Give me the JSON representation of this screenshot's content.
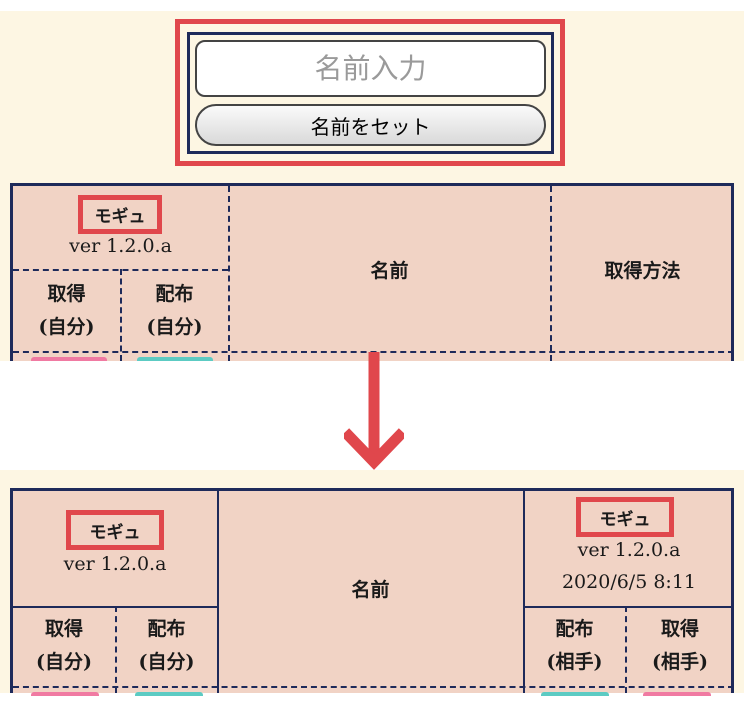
{
  "form": {
    "name_input_placeholder": "名前入力",
    "set_name_button": "名前をセット"
  },
  "before_table": {
    "game_badge": "モギュ",
    "version": "ver 1.2.0.a",
    "col_get_line1": "取得",
    "col_get_line2": "(自分)",
    "col_dist_line1": "配布",
    "col_dist_line2": "(自分)",
    "col_name": "名前",
    "col_method": "取得方法"
  },
  "after_table": {
    "game_badge": "モギュ",
    "version": "ver 1.2.0.a",
    "col_get_line1": "取得",
    "col_get_line2": "(自分)",
    "col_dist_line1": "配布",
    "col_dist_line2": "(自分)",
    "col_name": "名前",
    "partner_badge": "モギュ",
    "partner_version": "ver 1.2.0.a",
    "partner_datetime": "2020/6/5 8:11",
    "col_partner_dist_line1": "配布",
    "col_partner_dist_line2": "(相手)",
    "col_partner_get_line1": "取得",
    "col_partner_get_line2": "(相手)"
  },
  "colors": {
    "highlight": "#e0474c",
    "border": "#1e2a5a",
    "cell_bg": "#f1d3c5",
    "panel_bg": "#fdf6e3"
  },
  "icons": {
    "transition": "arrow-down-icon"
  }
}
